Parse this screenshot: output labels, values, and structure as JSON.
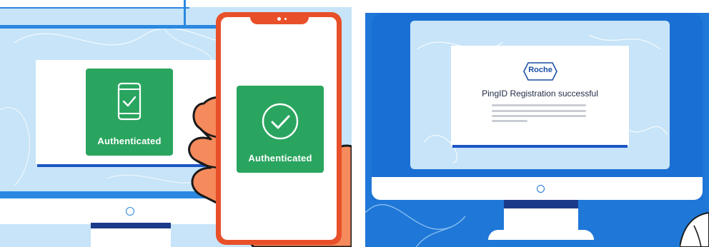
{
  "left_scene": {
    "monitor_card": {
      "icon": "phone-check-icon",
      "label": "Authenticated",
      "color": "#2aa55f"
    },
    "phone_card": {
      "icon": "check-circle-icon",
      "label": "Authenticated",
      "color": "#2aa55f"
    },
    "phone_frame_color": "#e8502a",
    "monitor_power_icon": "power-button-icon"
  },
  "right_scene": {
    "logo_text": "Roche",
    "message": "PingID Registration successful",
    "brand_blue": "#1f77d8",
    "monitor_power_icon": "power-button-icon"
  }
}
